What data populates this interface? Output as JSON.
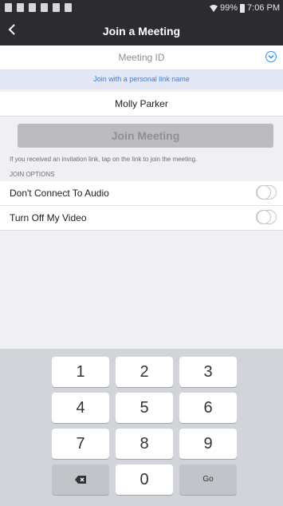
{
  "status_bar": {
    "battery": "99%",
    "time": "7:06 PM"
  },
  "nav": {
    "title": "Join a Meeting",
    "back_icon": "chevron-left-icon"
  },
  "form": {
    "meeting_id_placeholder": "Meeting ID",
    "personal_link_text": "Join with a personal link name",
    "name_value": "Molly Parker",
    "join_button_label": "Join Meeting",
    "hint": "If you received an invitation link, tap on the link to join the meeting."
  },
  "options": {
    "section_title": "JOIN OPTIONS",
    "items": [
      {
        "label": "Don't Connect To Audio"
      },
      {
        "label": "Turn Off My Video"
      }
    ]
  },
  "keypad": {
    "keys": [
      "1",
      "2",
      "3",
      "4",
      "5",
      "6",
      "7",
      "8",
      "9",
      "0"
    ],
    "go_label": "Go",
    "delete_icon": "backspace-icon"
  },
  "colors": {
    "accent": "#2f80ed",
    "header_bg": "#2b2b30",
    "keyboard_bg": "#d1d4d9"
  }
}
